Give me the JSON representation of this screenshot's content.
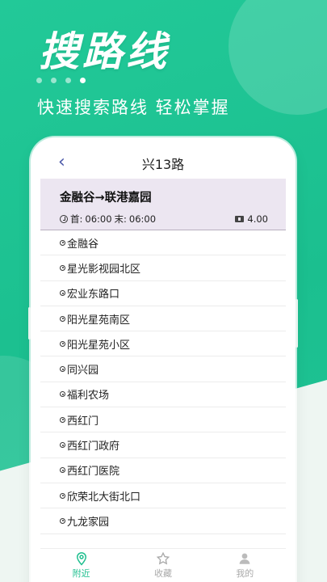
{
  "promo": {
    "headline": "搜路线",
    "subline": "快速搜索路线 轻松掌握",
    "carousel_dots": 4,
    "active_dot": 4
  },
  "nav": {
    "back_icon": "chevron-left-icon",
    "title": "兴13路"
  },
  "route": {
    "name": "金融谷→联港嘉园",
    "first_label": "首:",
    "first_time": "06:00",
    "last_label": "末:",
    "last_time": "06:00",
    "fare": "4.00"
  },
  "stops": [
    "金融谷",
    "星光影视园北区",
    "宏业东路口",
    "阳光星苑南区",
    "阳光星苑小区",
    "同兴园",
    "福利农场",
    "西红门",
    "西红门政府",
    "西红门医院",
    "欣荣北大街北口",
    "九龙家园"
  ],
  "tabbar": {
    "items": [
      {
        "label": "附近",
        "icon": "location-pin-icon",
        "active": true
      },
      {
        "label": "收藏",
        "icon": "star-icon",
        "active": false
      },
      {
        "label": "我的",
        "icon": "user-icon",
        "active": false
      }
    ]
  },
  "colors": {
    "brand_green": "#1fbf8f",
    "route_card_bg": "#ece6f1",
    "back_icon": "#4a57a8"
  }
}
